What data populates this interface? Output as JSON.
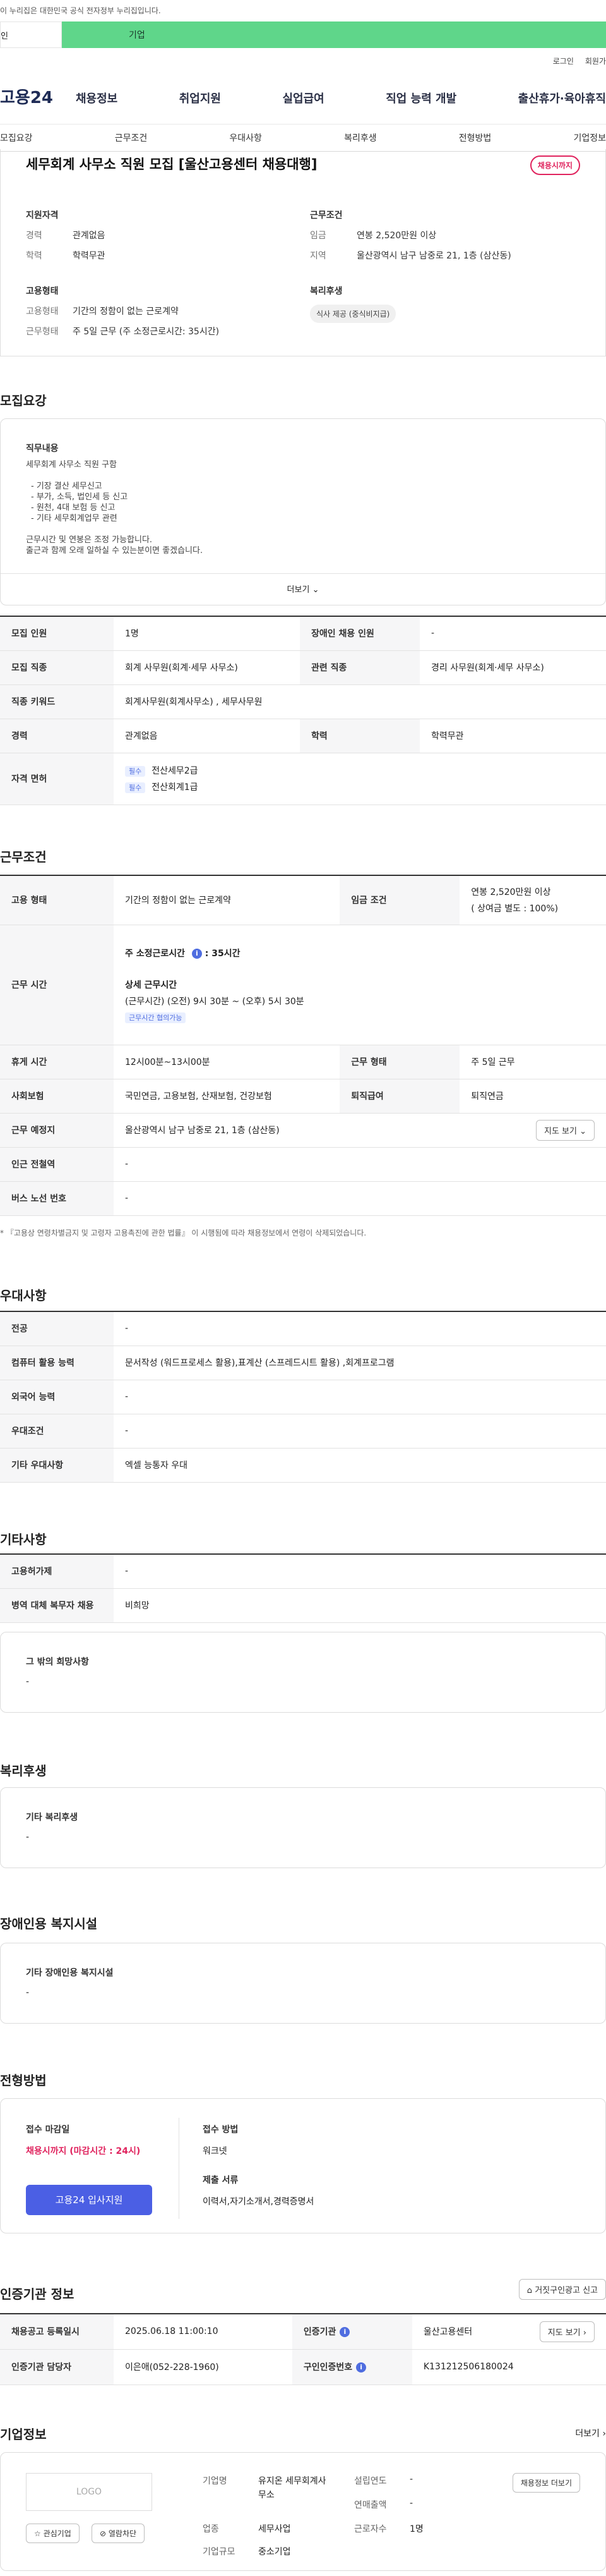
{
  "gov_banner": "이 누리집은 대한민국 공식 전자정부 누리집입니다.",
  "segment": {
    "left": "인",
    "right": "기업"
  },
  "utility": {
    "login": "로그인",
    "join": "회원가"
  },
  "logo": "고용24",
  "gnb": [
    "채용정보",
    "취업지원",
    "실업급여",
    "직업 능력 개발",
    "출산휴가·육아휴직"
  ],
  "subnav": [
    "모집요강",
    "근무조건",
    "우대사항",
    "복리후생",
    "전형방법",
    "기업정보"
  ],
  "job": {
    "title": "세무회계 사무소 직원 모집 [울산고용센터 채용대행]",
    "badge": "채용시까지",
    "qual_head": "지원자격",
    "career_k": "경력",
    "career_v": "관계없음",
    "edu_k": "학력",
    "edu_v": "학력무관",
    "emp_head": "고용형태",
    "emptype_k": "고용형태",
    "emptype_v": "기간의 정함이 없는 근로계약",
    "worktype_k": "근무형태",
    "worktype_v": "주 5일 근무 (주 소정근로시간: 35시간)",
    "cond_head": "근무조건",
    "wage_k": "임금",
    "wage_v": "연봉 2,520만원 이상",
    "region_k": "지역",
    "region_v": "울산광역시 남구 남중로 21, 1층 (삼산동)",
    "welfare_head": "복리후생",
    "welfare_pill": "식사 제공 (중식비지급)"
  },
  "recruit": {
    "section": "모집요강",
    "duty_head": "직무내용",
    "duty_lines": [
      "세무회계 사무소 직원 구함",
      "",
      "- 기장 결산 세무신고",
      "- 부가, 소득, 법인세 등 신고",
      "- 원천, 4대 보험 등 신고",
      "- 기타 세무회계업무 관련",
      "",
      "근무시간 및 연봉은 조정 가능합니다.",
      "출근과 함께 오래 일하실 수 있는분이면 좋겠습니다."
    ],
    "more": "더보기",
    "rows": {
      "count_k": "모집 인원",
      "count_v": "1명",
      "disabled_k": "장애인 채용 인원",
      "disabled_v": "-",
      "job_k": "모집 직종",
      "job_v": "회계 사무원(회계·세무 사무소)",
      "rel_k": "관련 직종",
      "rel_v": "경리 사무원(회계·세무 사무소)",
      "kw_k": "직종 키워드",
      "kw_v": "회계사무원(회계사무소) , 세무사무원",
      "career_k": "경력",
      "career_v": "관계없음",
      "edu_k": "학력",
      "edu_v": "학력무관",
      "license_k": "자격 면허",
      "license_tag": "필수",
      "licenses": [
        "전산세무2급",
        "전산회계1급"
      ]
    }
  },
  "conditions": {
    "section": "근무조건",
    "emptype_k": "고용 형태",
    "emptype_v": "기간의 정함이 없는 근로계약",
    "wage_k": "임금 조건",
    "wage_v1": "연봉 2,520만원 이상",
    "wage_v2": "( 상여금 별도 : 100%)",
    "hours_k": "근무 시간",
    "hours_main_label": "주 소정근로시간",
    "hours_main_val": "35시간",
    "hours_detail_label": "상세 근무시간",
    "hours_detail_val": "(근무시간) (오전) 9시 30분 ~ (오후) 5시 30분",
    "hours_tag": "근무시간 협의가능",
    "break_k": "휴게 시간",
    "break_v": "12시00분~13시00분",
    "form_k": "근무 형태",
    "form_v": "주 5일 근무",
    "ins_k": "사회보험",
    "ins_v": "국민연금, 고용보험, 산재보험, 건강보험",
    "sev_k": "퇴직급여",
    "sev_v": "퇴직연금",
    "loc_k": "근무 예정지",
    "loc_v": "울산광역시 남구 남중로 21, 1층 (삼산동)",
    "map_btn": "지도 보기",
    "subway_k": "인근 전철역",
    "subway_v": "-",
    "bus_k": "버스 노선 번호",
    "bus_v": "-",
    "note": "* 『고용상 연령차별금지 및 고령자 고용촉진에 관한 법률』 이 시행됨에 따라 채용정보에서 연령이 삭제되었습니다."
  },
  "pref": {
    "section": "우대사항",
    "major_k": "전공",
    "major_v": "-",
    "pc_k": "컴퓨터 활용 능력",
    "pc_v": "문서작성 (워드프로세스 활용),표계산 (스프레드시트 활용) ,회계프로그램",
    "lang_k": "외국어 능력",
    "lang_v": "-",
    "cond_k": "우대조건",
    "cond_v": "-",
    "etc_k": "기타 우대사항",
    "etc_v": "엑셀 능통자 우대"
  },
  "etc": {
    "section": "기타사항",
    "type_k": "고용허가제",
    "type_v": "-",
    "mil_k": "병역 대체 복무자 채용",
    "mil_v": "비희망",
    "wish_head": "그 밖의 희망사항",
    "wish_v": "-"
  },
  "welfare": {
    "section": "복리후생",
    "head": "기타 복리후생",
    "value": "-"
  },
  "disability": {
    "section": "장애인용 복지시설",
    "head": "기타 장애인용 복지시설",
    "value": "-"
  },
  "process": {
    "section": "전형방법",
    "deadline_head": "접수 마감일",
    "deadline_v": "채용시까지 (마감시간 : 24시)",
    "apply_btn": "고용24 입사지원",
    "method_head": "접수 방법",
    "method_v": "워크넷",
    "docs_head": "제출 서류",
    "docs_v": "이력서,자기소개서,경력증명서"
  },
  "cert": {
    "section": "인증기관 정보",
    "report_btn": "거짓구인광고 신고",
    "reg_k": "채용공고 등록일시",
    "reg_v": "2025.06.18 11:00:10",
    "org_k": "인증기관",
    "org_v": "울산고용센터",
    "map_btn": "지도 보기",
    "mgr_k": "인증기관 담당자",
    "mgr_v": "이은애(052-228-1960)",
    "num_k": "구인인증번호",
    "num_v": "K131212506180024"
  },
  "company": {
    "section": "기업정보",
    "more": "더보기",
    "logo_ph": "LOGO",
    "fav_btn": "관심기업",
    "block_btn": "열람차단",
    "name_k": "기업명",
    "name_v": "유지온 세무회계사무소",
    "ind_k": "업종",
    "ind_v": "세무사업",
    "size_k": "기업규모",
    "size_v": "중소기업",
    "est_k": "설립연도",
    "est_v": "-",
    "rev_k": "연매출액",
    "rev_v": "-",
    "emp_k": "근로자수",
    "emp_v": "1명",
    "list_btn": "채용정보 더보기"
  },
  "colors": {
    "accent_blue": "#4b5fe4",
    "accent_red": "#e0245e",
    "segment_green": "#5fd68a"
  }
}
